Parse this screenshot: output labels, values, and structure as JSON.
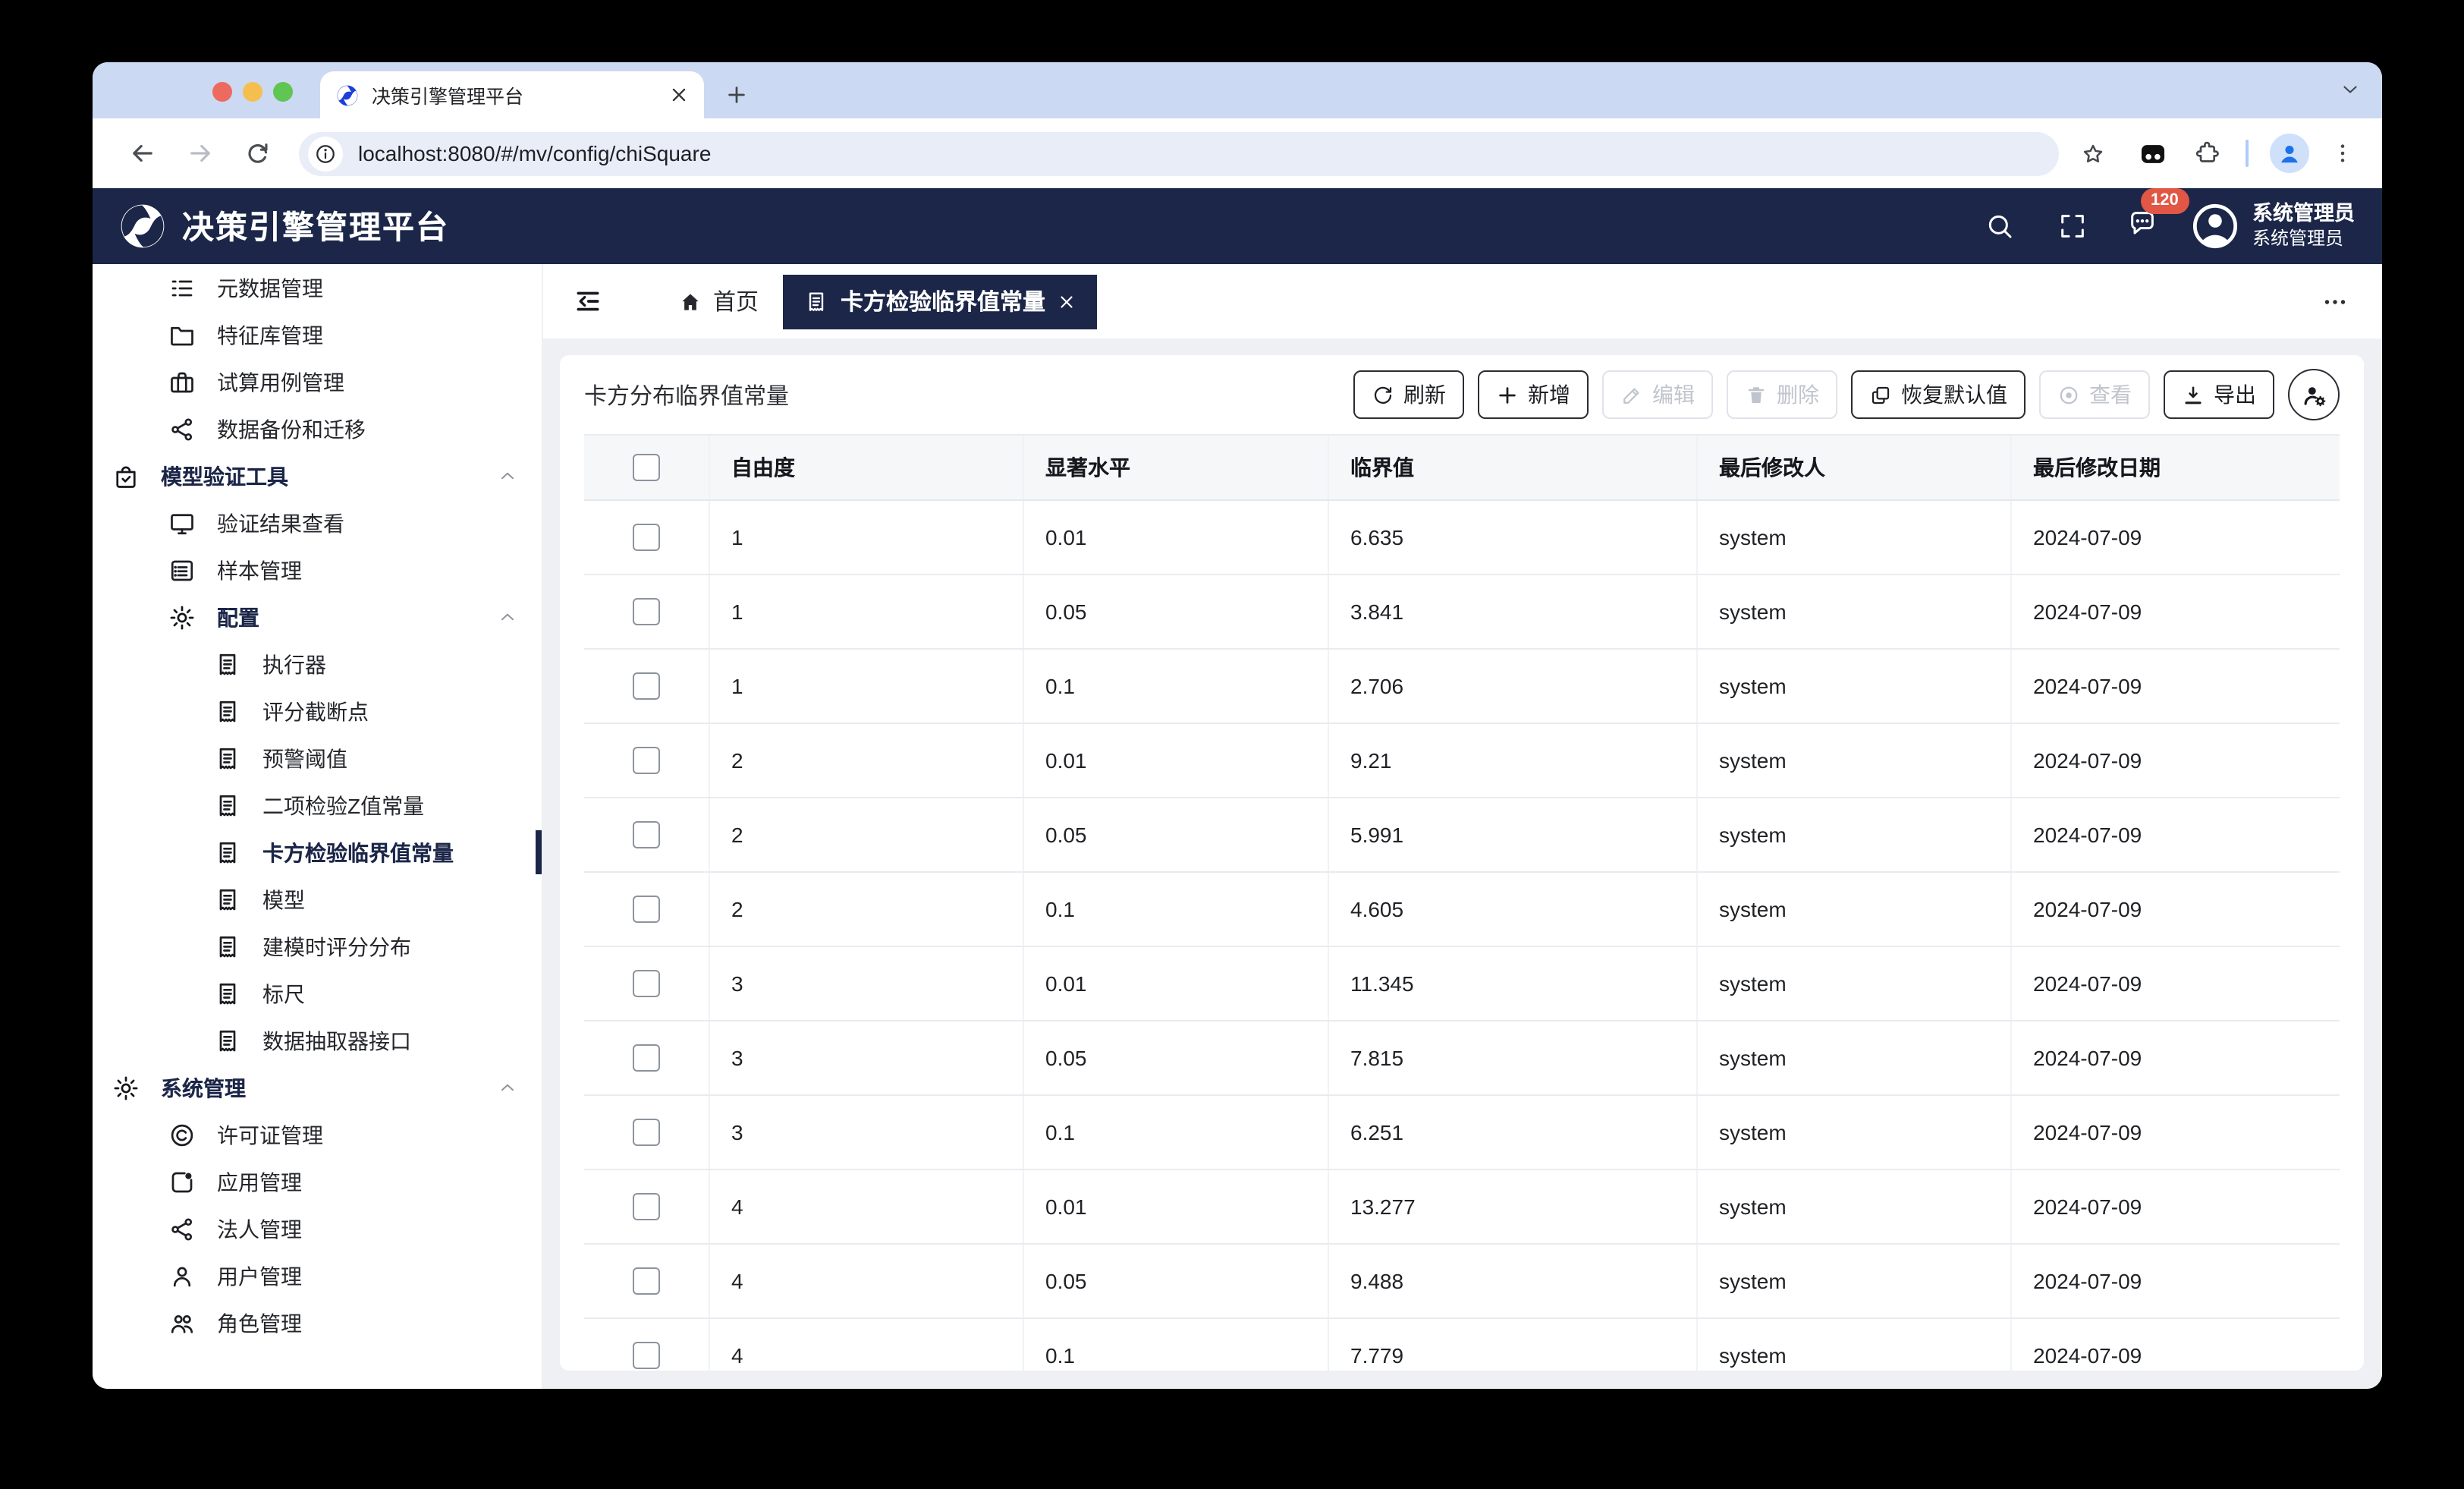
{
  "browser": {
    "tab_title": "决策引擎管理平台",
    "url": "localhost:8080/#/mv/config/chiSquare"
  },
  "header": {
    "title": "决策引擎管理平台",
    "message_count": "120",
    "user_name": "系统管理员",
    "user_role": "系统管理员"
  },
  "tabbar": {
    "home_label": "首页",
    "active_tab_label": "卡方检验临界值常量"
  },
  "sidebar": {
    "items": [
      {
        "label": "元数据管理",
        "icon": "ordered-list-icon",
        "level": 1
      },
      {
        "label": "特征库管理",
        "icon": "folder-icon",
        "level": 1
      },
      {
        "label": "试算用例管理",
        "icon": "briefcase-icon",
        "level": 1
      },
      {
        "label": "数据备份和迁移",
        "icon": "share-icon",
        "level": 1
      },
      {
        "label": "模型验证工具",
        "icon": "bag-check-icon",
        "level": 0,
        "type": "group",
        "arrow": true
      },
      {
        "label": "验证结果查看",
        "icon": "monitor-icon",
        "level": 1
      },
      {
        "label": "样本管理",
        "icon": "list-card-icon",
        "level": 1
      },
      {
        "label": "配置",
        "icon": "gear-icon",
        "level": 1,
        "type": "group",
        "arrow": true
      },
      {
        "label": "执行器",
        "icon": "receipt-icon",
        "level": 2
      },
      {
        "label": "评分截断点",
        "icon": "receipt-icon",
        "level": 2
      },
      {
        "label": "预警阈值",
        "icon": "receipt-icon",
        "level": 2
      },
      {
        "label": "二项检验Z值常量",
        "icon": "receipt-icon",
        "level": 2
      },
      {
        "label": "卡方检验临界值常量",
        "icon": "receipt-icon",
        "level": 2,
        "state": "active"
      },
      {
        "label": "模型",
        "icon": "receipt-icon",
        "level": 2
      },
      {
        "label": "建模时评分分布",
        "icon": "receipt-icon",
        "level": 2
      },
      {
        "label": "标尺",
        "icon": "receipt-icon",
        "level": 2
      },
      {
        "label": "数据抽取器接口",
        "icon": "receipt-icon",
        "level": 2
      },
      {
        "label": "系统管理",
        "icon": "gear-icon",
        "level": 0,
        "type": "group",
        "arrow": true
      },
      {
        "label": "许可证管理",
        "icon": "copyright-icon",
        "level": 1
      },
      {
        "label": "应用管理",
        "icon": "app-icon",
        "level": 1
      },
      {
        "label": "法人管理",
        "icon": "share-icon",
        "level": 1
      },
      {
        "label": "用户管理",
        "icon": "person-icon",
        "level": 1
      },
      {
        "label": "角色管理",
        "icon": "people-icon",
        "level": 1
      }
    ]
  },
  "toolbar": {
    "title": "卡方分布临界值常量",
    "buttons": [
      {
        "label": "刷新",
        "icon": "refresh-icon"
      },
      {
        "label": "新增",
        "icon": "plus-icon"
      },
      {
        "label": "编辑",
        "icon": "edit-icon",
        "state": "disabled"
      },
      {
        "label": "删除",
        "icon": "trash-icon",
        "state": "disabled"
      },
      {
        "label": "恢复默认值",
        "icon": "restore-icon"
      },
      {
        "label": "查看",
        "icon": "view-icon",
        "state": "disabled"
      },
      {
        "label": "导出",
        "icon": "export-icon"
      }
    ]
  },
  "table": {
    "columns": [
      "自由度",
      "显著水平",
      "临界值",
      "最后修改人",
      "最后修改日期"
    ],
    "rows": [
      [
        "1",
        "0.01",
        "6.635",
        "system",
        "2024-07-09"
      ],
      [
        "1",
        "0.05",
        "3.841",
        "system",
        "2024-07-09"
      ],
      [
        "1",
        "0.1",
        "2.706",
        "system",
        "2024-07-09"
      ],
      [
        "2",
        "0.01",
        "9.21",
        "system",
        "2024-07-09"
      ],
      [
        "2",
        "0.05",
        "5.991",
        "system",
        "2024-07-09"
      ],
      [
        "2",
        "0.1",
        "4.605",
        "system",
        "2024-07-09"
      ],
      [
        "3",
        "0.01",
        "11.345",
        "system",
        "2024-07-09"
      ],
      [
        "3",
        "0.05",
        "7.815",
        "system",
        "2024-07-09"
      ],
      [
        "3",
        "0.1",
        "6.251",
        "system",
        "2024-07-09"
      ],
      [
        "4",
        "0.01",
        "13.277",
        "system",
        "2024-07-09"
      ],
      [
        "4",
        "0.05",
        "9.488",
        "system",
        "2024-07-09"
      ],
      [
        "4",
        "0.1",
        "7.779",
        "system",
        "2024-07-09"
      ]
    ]
  }
}
